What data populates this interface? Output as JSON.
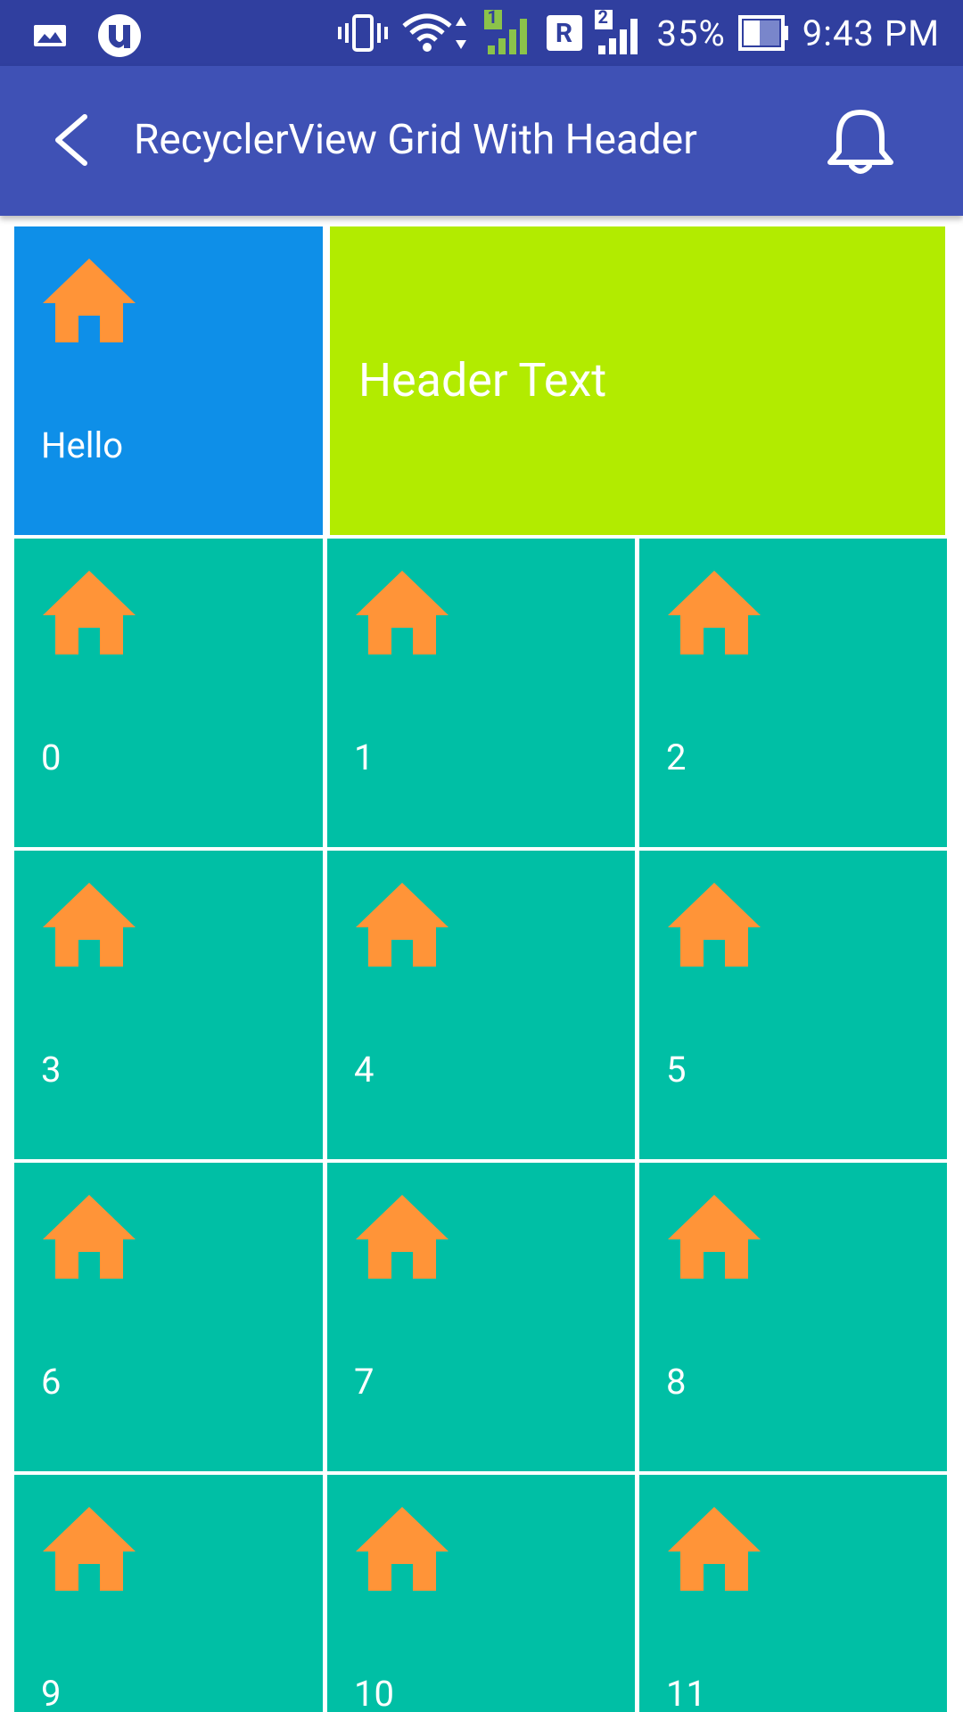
{
  "status_bar": {
    "battery_percent": "35%",
    "time": "9:43 PM",
    "sim1": "1",
    "roaming": "R",
    "sim2": "2",
    "icons": [
      "gallery-icon",
      "utorrent-icon",
      "vibrate-icon",
      "wifi-icon",
      "signal-sim1-icon",
      "roaming-icon",
      "signal-sim2-icon",
      "battery-icon"
    ]
  },
  "app_bar": {
    "title": "RecyclerView Grid With Header",
    "back_icon": "back-arrow-icon",
    "action_icon": "bell-icon"
  },
  "grid": {
    "colors": {
      "first_tile": "#0e8fe8",
      "header": "#b2eb00",
      "item": "#00bfa5",
      "house": "#ff9438"
    },
    "first_tile": {
      "label": "Hello",
      "icon": "home-icon"
    },
    "header": {
      "text": "Header Text"
    },
    "items": [
      {
        "label": "0",
        "icon": "home-icon"
      },
      {
        "label": "1",
        "icon": "home-icon"
      },
      {
        "label": "2",
        "icon": "home-icon"
      },
      {
        "label": "3",
        "icon": "home-icon"
      },
      {
        "label": "4",
        "icon": "home-icon"
      },
      {
        "label": "5",
        "icon": "home-icon"
      },
      {
        "label": "6",
        "icon": "home-icon"
      },
      {
        "label": "7",
        "icon": "home-icon"
      },
      {
        "label": "8",
        "icon": "home-icon"
      },
      {
        "label": "9",
        "icon": "home-icon"
      },
      {
        "label": "10",
        "icon": "home-icon"
      },
      {
        "label": "11",
        "icon": "home-icon"
      }
    ]
  }
}
